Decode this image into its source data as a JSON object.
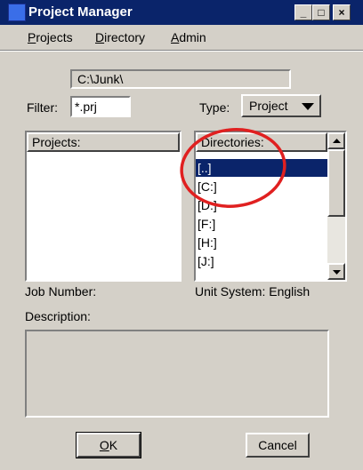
{
  "window": {
    "title": "Project Manager"
  },
  "title_buttons": {
    "minimize": "_",
    "maximize": "□",
    "close": "×"
  },
  "menu": {
    "projects": {
      "accel": "P",
      "rest": "rojects"
    },
    "directory": {
      "accel": "D",
      "rest": "irectory"
    },
    "admin": {
      "accel": "A",
      "rest": "dmin"
    }
  },
  "path_field": {
    "value": "C:\\Junk\\"
  },
  "filter": {
    "label": "Filter:",
    "value": "*.prj"
  },
  "type": {
    "label": "Type:",
    "selected": "Project"
  },
  "projects_list": {
    "header": "Projects:"
  },
  "directories_list": {
    "header": "Directories:",
    "items": [
      "[..]",
      "[C:]",
      "[D:]",
      "[F:]",
      "[H:]",
      "[J:]"
    ],
    "selected_index": 0
  },
  "job_number": {
    "label": "Job Number:"
  },
  "unit_system": {
    "label": "Unit System: English"
  },
  "description": {
    "label": "Description:"
  },
  "buttons": {
    "ok": {
      "accel": "O",
      "rest": "K"
    },
    "cancel": "Cancel"
  },
  "annotation": {
    "color": "#e02020"
  }
}
